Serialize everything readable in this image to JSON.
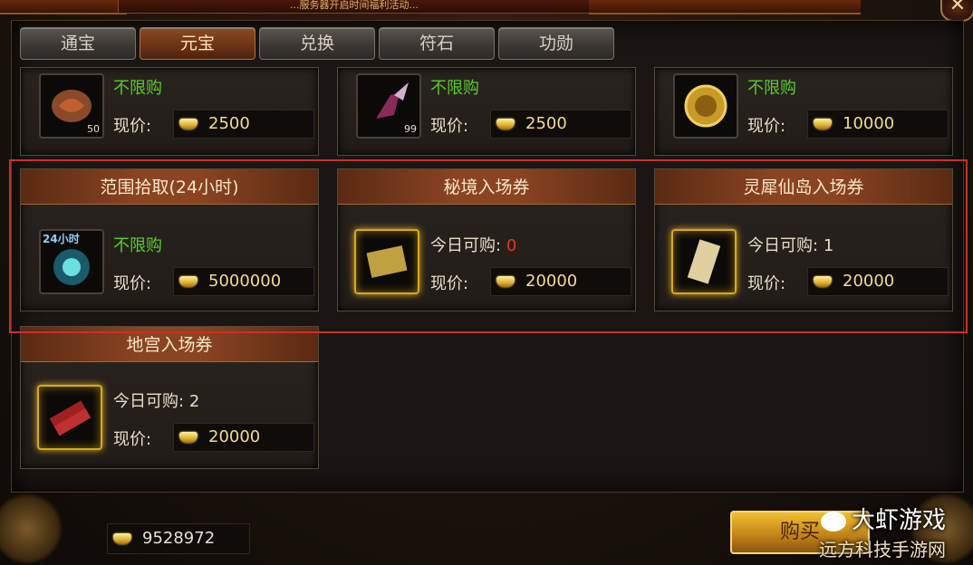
{
  "header": {
    "banner_text": "...服务器开启时间福利活动..."
  },
  "tabs": [
    {
      "label": "通宝",
      "active": false
    },
    {
      "label": "元宝",
      "active": true
    },
    {
      "label": "兑换",
      "active": false
    },
    {
      "label": "符石",
      "active": false
    },
    {
      "label": "功勋",
      "active": false
    }
  ],
  "items": [
    {
      "title": "",
      "limit_label": "不限购",
      "price_label": "现价:",
      "price": "2500",
      "count": "50",
      "icon": "dragon-ore-icon"
    },
    {
      "title": "",
      "limit_label": "不限购",
      "price_label": "现价:",
      "price": "2500",
      "count": "99",
      "icon": "wing-boot-icon"
    },
    {
      "title": "",
      "limit_label": "不限购",
      "price_label": "现价:",
      "price": "10000",
      "count": "",
      "icon": "gold-medal-icon"
    },
    {
      "title": "范围拾取(24小时)",
      "limit_label": "不限购",
      "price_label": "现价:",
      "price": "5000000",
      "count": "",
      "icon_tag": "24小时",
      "icon": "orb-icon"
    },
    {
      "title": "秘境入场券",
      "limit_label": "今日可购:",
      "limit_value": "0",
      "price_label": "现价:",
      "price": "20000",
      "icon": "scroll-icon"
    },
    {
      "title": "灵犀仙岛入场券",
      "limit_label": "今日可购:",
      "limit_value": "1",
      "price_label": "现价:",
      "price": "20000",
      "icon": "ticket-icon"
    },
    {
      "title": "地宫入场券",
      "limit_label": "今日可购:",
      "limit_value": "2",
      "price_label": "现价:",
      "price": "20000",
      "icon": "firecracker-icon"
    }
  ],
  "footer": {
    "balance": "9528972",
    "buy_label": "购买"
  },
  "watermark": {
    "line1": "大虾游戏",
    "line2": "远方科技手游网"
  },
  "colors": {
    "highlight_border": "#c8302a",
    "unlimited_green": "#5acc2a",
    "zero_red": "#e23820"
  }
}
